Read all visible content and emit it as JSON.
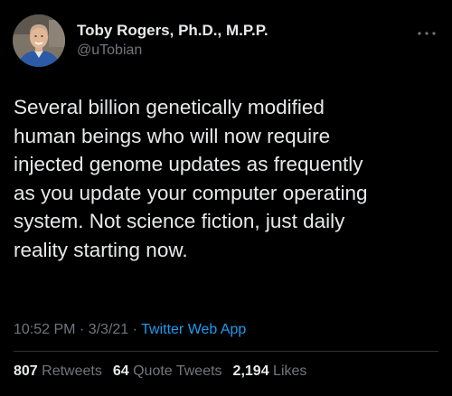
{
  "author": {
    "name": "Toby Rogers, Ph.D., M.P.P.",
    "handle": "@uTobian",
    "avatar": "profile-photo"
  },
  "more_icon": "more-dots-icon",
  "tweet": {
    "lines": [
      "Several billion genetically modified",
      "human beings who will now require",
      "injected genome updates as frequently",
      "as you update your computer operating",
      "system. Not science fiction, just daily",
      "reality starting now."
    ]
  },
  "meta": {
    "time": "10:52 PM",
    "sep1": " · ",
    "date": "3/3/21",
    "sep2": " · ",
    "app": "Twitter Web App"
  },
  "stats": {
    "retweets_count": "807",
    "retweets_label": "Retweets",
    "quotes_count": "64",
    "quotes_label": "Quote Tweets",
    "likes_count": "2,194",
    "likes_label": "Likes"
  },
  "colors": {
    "background": "#000000",
    "text": "#e7e9ea",
    "secondary": "#71767b",
    "link": "#1d9bf0"
  }
}
